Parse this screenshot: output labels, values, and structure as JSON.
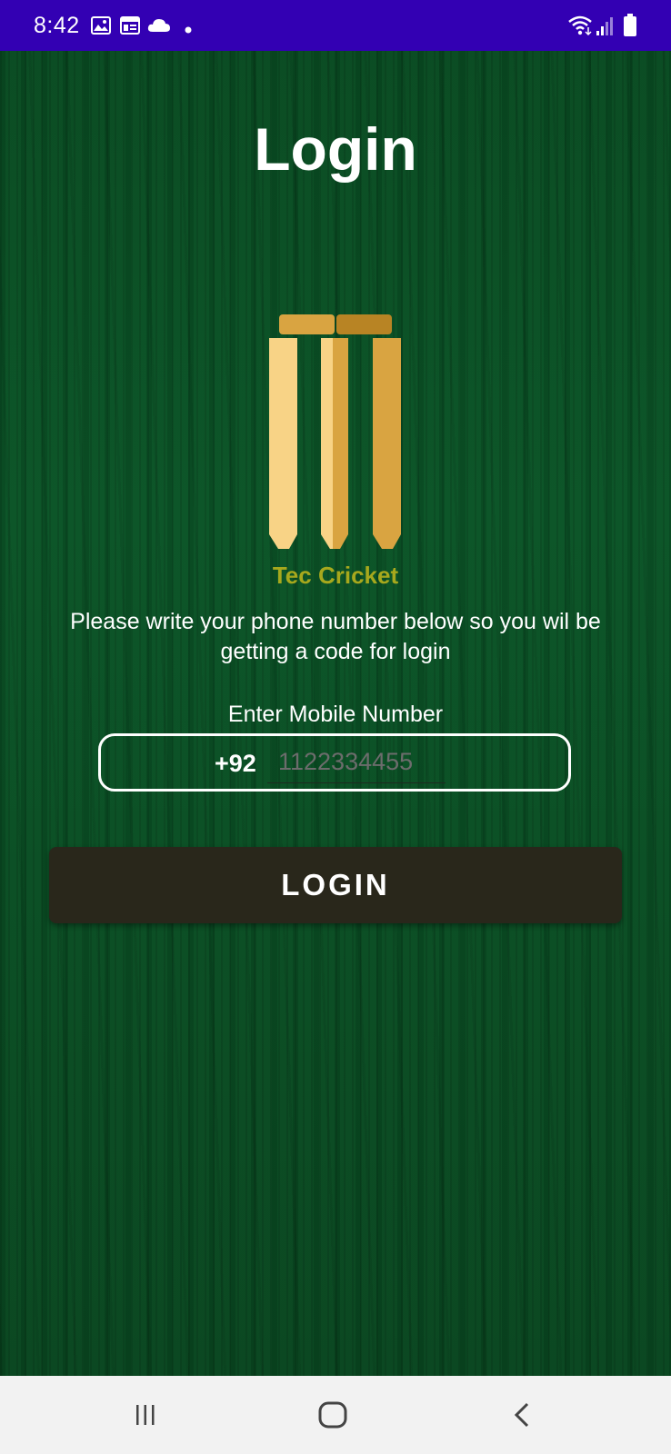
{
  "status_bar": {
    "time": "8:42",
    "left_icons": [
      "image-icon",
      "calendar-icon",
      "cloud-icon",
      "dot-icon"
    ],
    "right_icons": [
      "wifi-icon",
      "signal-icon",
      "battery-icon"
    ],
    "background_color": "#3300b3"
  },
  "login_screen": {
    "title": "Login",
    "app_name": "Tec Cricket",
    "instructions": "Please write your phone number below so you wil be getting a code for login",
    "field_label": "Enter Mobile Number",
    "country_code": "+92",
    "phone_placeholder": "1122334455",
    "phone_value": "",
    "login_button_label": "LOGIN",
    "logo_icon": "cricket-stumps-icon",
    "colors": {
      "background": "#0b4d24",
      "app_name": "#a7a81d",
      "button": "#29271b",
      "stump_light": "#f8d386",
      "stump_dark": "#d9a441"
    }
  },
  "nav_bar": {
    "buttons": [
      "recent-apps-icon",
      "home-icon",
      "back-icon"
    ]
  }
}
